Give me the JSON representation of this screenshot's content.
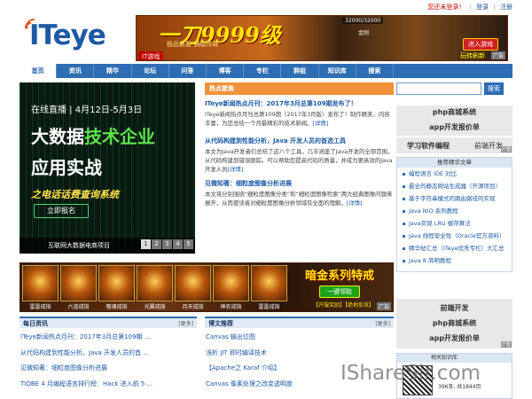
{
  "top_links": {
    "not_logged_in": "您还未登录！",
    "login": "登录",
    "register": "注册"
  },
  "logo": {
    "text": "ITeye"
  },
  "top_ad": {
    "title": "一刀9999级",
    "hp": "32000/32000",
    "subtitle": "极品装备  满级传奇",
    "tag": "IT游戏",
    "char_name": "金刚",
    "button": "进入游戏",
    "button2": "玩转刷新",
    "ad_label": "广告"
  },
  "nav": {
    "items": [
      {
        "label": "首页",
        "active": true
      },
      {
        "label": "资讯"
      },
      {
        "label": "精华"
      },
      {
        "label": "论坛"
      },
      {
        "label": "问答"
      },
      {
        "label": "博客"
      },
      {
        "label": "专栏"
      },
      {
        "label": "群组"
      },
      {
        "label": "知识库"
      },
      {
        "label": "搜索"
      }
    ]
  },
  "hero": {
    "live": "在线直播 | 4月12日-5月3日",
    "line1_white": "大数据",
    "line1_green": "技术企业",
    "line2": "应用实战",
    "line3": "之电话话费查询系统",
    "button": "立即报名",
    "caption": "互联网大数据电商项目",
    "pages": [
      "1",
      "2",
      "3",
      "4",
      "5"
    ]
  },
  "hot": {
    "header": "热点聚焦",
    "items": [
      {
        "title": "ITeye新闻热点月刊：2017年3月总第109期发布了！",
        "desc": "ITeye新闻热点月刊总第109期（2017年3月版）发布了！制作精美，内容丰富，为您总结一个月最精彩的技术新闻。",
        "more": "[详情]"
      },
      {
        "title": "从代码构建到性能分析，Java 开发人员的首选工具",
        "desc": "本文为Java开发者们总结了这八个工具，几乎涵盖了Java开发的全部范围，从代码构建到错误跟踪。可以帮助您提高代码的质量，并成为更高效的Java开发人员",
        "more": "[详情]"
      },
      {
        "title": "见微知著：细粒度图像分析进展",
        "desc": "本文将分别围绕“细粒度图像分类”和“细粒度图像检索”两大经典图像问题来展开，从而使读者对细粒度图像分析领域有全面的理解。",
        "more": "[详情]"
      }
    ]
  },
  "search": {
    "placeholder": "",
    "button": "搜索"
  },
  "right_ad1": {
    "line1": "php商城系统",
    "line2": "app开发报价单"
  },
  "right_ad2": {
    "a": "学习软件编程",
    "b": "前端开发",
    "ad_label": "广告"
  },
  "recommend": {
    "header": "推荐精华文章",
    "items": [
      "编程语言 IDE 对比",
      "最全的静态网站生成器（开源项目）",
      "基于字符串模式的路由路径的实现",
      "Java NIO 系列教程",
      "Java实现 LRU 缓存算法",
      "Java 线程安全性（Oracle官方资料）",
      "精华帖汇总（ITeye优秀专栏）大汇总",
      "Java 8 简明教程"
    ]
  },
  "right_ad3": {
    "l1": "前端开发",
    "l2": "php商城系统",
    "l3": "app开发报价单",
    "ad_label": "广告"
  },
  "knowledge": {
    "header": "相关知识库",
    "count": "396条, 共1844页"
  },
  "games": {
    "names": [
      "雷霆戒指",
      "六道戒指",
      "噬魂戒指",
      "光翼戒指",
      "月天戒指",
      "神农戒指",
      "雷霆戒指"
    ],
    "title": "暗金系列特戒",
    "button": "一键领取",
    "sub": "【开服奖励】【绝地反攻】",
    "ad_label": "广告"
  },
  "daily": {
    "header": "每日资讯",
    "more": "[更多]",
    "items": [
      "ITeye新闻热点月刊：2017年3月总第109期 ...",
      "从代码构建到性能分析，Java 开发人员的首 ...",
      "见微知著：细粒度图像分析进展",
      "TIOBE 4 月编程语言排行榜：Hack 进入前 5 ..."
    ]
  },
  "blog": {
    "header": "博文推荐",
    "more": "[更多]",
    "items": [
      "Canvas 输出位图",
      "浅析 JIT 即时编译技术",
      "【Apache之 Karaf 介绍】",
      "Canvas 像素处理之改变透明度"
    ]
  },
  "watermark": {
    "text": "IShareSir.com"
  }
}
